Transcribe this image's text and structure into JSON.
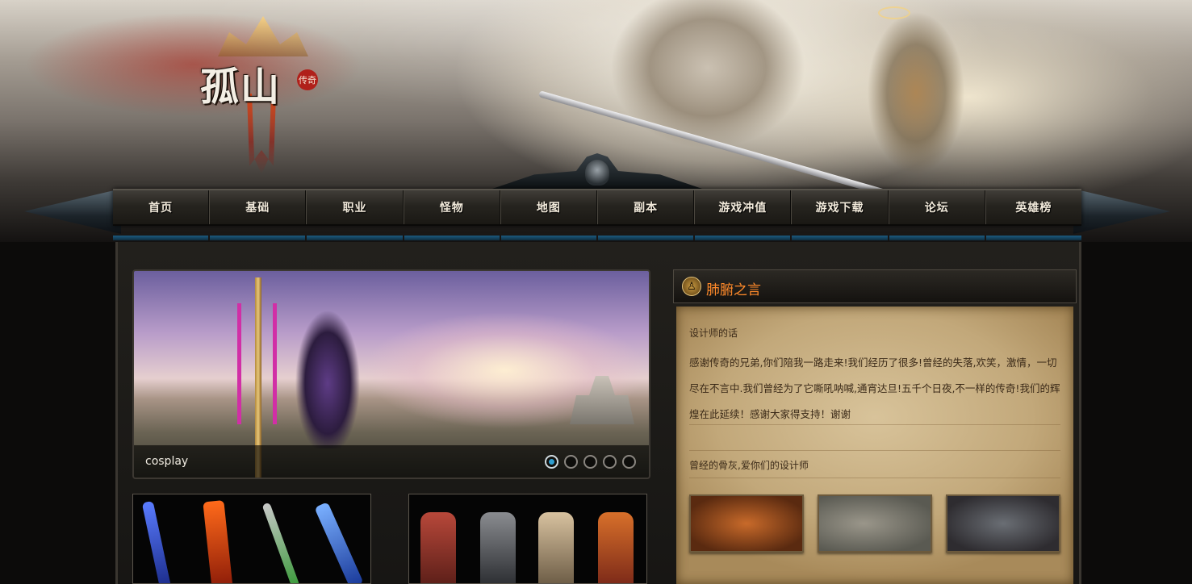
{
  "site": {
    "logo_text": "孤山",
    "logo_seal": "传奇"
  },
  "nav": {
    "items": [
      {
        "label": "首页"
      },
      {
        "label": "基础"
      },
      {
        "label": "职业"
      },
      {
        "label": "怪物"
      },
      {
        "label": "地图"
      },
      {
        "label": "副本"
      },
      {
        "label": "游戏冲值"
      },
      {
        "label": "游戏下载"
      },
      {
        "label": "论坛"
      },
      {
        "label": "英雄榜"
      }
    ]
  },
  "slider": {
    "caption": "cosplay",
    "dot_count": 5,
    "active_index": 0
  },
  "sidebar": {
    "title": "肺腑之言",
    "heading": "设计师的话",
    "body": "感谢传奇的兄弟,你们陪我一路走来!我们经历了很多!曾经的失落,欢笑，激情，一切尽在不言中.我们曾经为了它嘶吼呐喊,通宵达旦!五千个日夜,不一样的传奇!我们的辉煌在此延续！感谢大家得支持！谢谢",
    "signature": "曾经的骨灰,爱你们的设计师"
  },
  "colors": {
    "accent_orange": "#ff8a2a",
    "nav_underline_blue": "#1c5b80",
    "dot_active": "#2f9ecf"
  }
}
